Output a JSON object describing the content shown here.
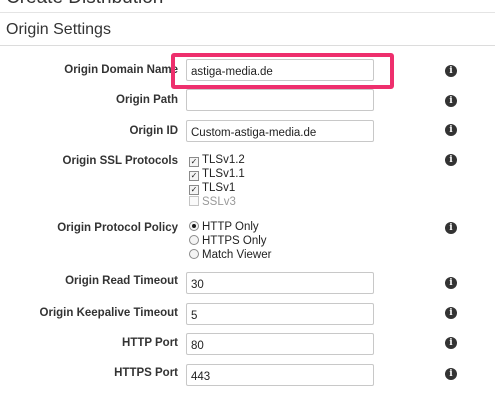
{
  "page": {
    "title": "Create Distribution"
  },
  "section": {
    "title": "Origin Settings"
  },
  "fields": {
    "origin_domain_name": {
      "label": "Origin Domain Name",
      "value": "astiga-media.de"
    },
    "origin_path": {
      "label": "Origin Path",
      "value": ""
    },
    "origin_id": {
      "label": "Origin ID",
      "value": "Custom-astiga-media.de"
    },
    "ssl_protocols": {
      "label": "Origin SSL Protocols",
      "options": [
        {
          "label": "TLSv1.2",
          "checked": true,
          "disabled": false
        },
        {
          "label": "TLSv1.1",
          "checked": true,
          "disabled": false
        },
        {
          "label": "TLSv1",
          "checked": true,
          "disabled": false
        },
        {
          "label": "SSLv3",
          "checked": false,
          "disabled": true
        }
      ]
    },
    "protocol_policy": {
      "label": "Origin Protocol Policy",
      "options": [
        {
          "label": "HTTP Only",
          "selected": true
        },
        {
          "label": "HTTPS Only",
          "selected": false
        },
        {
          "label": "Match Viewer",
          "selected": false
        }
      ]
    },
    "read_timeout": {
      "label": "Origin Read Timeout",
      "value": "30"
    },
    "keepalive_timeout": {
      "label": "Origin Keepalive Timeout",
      "value": "5"
    },
    "http_port": {
      "label": "HTTP Port",
      "value": "80"
    },
    "https_port": {
      "label": "HTTPS Port",
      "value": "443"
    }
  },
  "icons": {
    "info": "i"
  },
  "colors": {
    "highlight": "#ee2f6d"
  }
}
